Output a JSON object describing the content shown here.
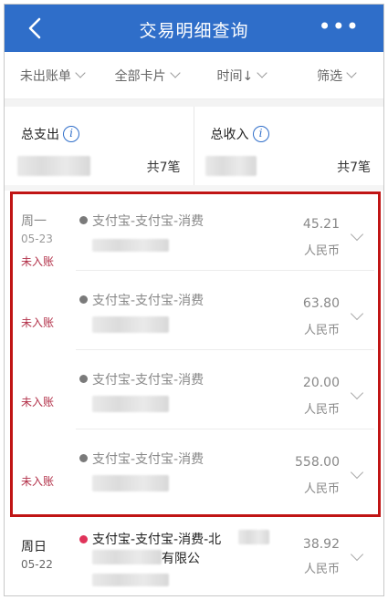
{
  "header": {
    "title": "交易明细查询",
    "more_label": "•••"
  },
  "filters": [
    {
      "label": "未出账单"
    },
    {
      "label": "全部卡片"
    },
    {
      "label": "时间↓"
    },
    {
      "label": "筛选"
    }
  ],
  "summary": {
    "expense_label": "总支出",
    "expense_count": "共7笔",
    "income_label": "总收入",
    "income_count": "共7笔",
    "info_glyph": "i"
  },
  "transactions": [
    {
      "weekday": "周一",
      "date": "05-23",
      "status": "未入账",
      "merchant": "支付宝-支付宝-消费",
      "amount": "45.21",
      "currency": "人民币"
    },
    {
      "weekday": "",
      "date": "",
      "status": "未入账",
      "merchant": "支付宝-支付宝-消费",
      "amount": "63.80",
      "currency": "人民币"
    },
    {
      "weekday": "",
      "date": "",
      "status": "未入账",
      "merchant": "支付宝-支付宝-消费",
      "amount": "20.00",
      "currency": "人民币"
    },
    {
      "weekday": "",
      "date": "",
      "status": "未入账",
      "merchant": "支付宝-支付宝-消费",
      "amount": "558.00",
      "currency": "人民币"
    }
  ],
  "last_transaction": {
    "weekday": "周日",
    "date": "05-22",
    "merchant_line1": "支付宝-支付宝-消费-北",
    "merchant_line2": "有限公",
    "amount": "38.92",
    "currency": "人民币"
  },
  "colors": {
    "header_bg": "#2f6ec9",
    "pending_text": "#b3324a",
    "highlight_border": "#c01515",
    "dot_grey": "#7a7a7a",
    "dot_red": "#e0335a"
  }
}
